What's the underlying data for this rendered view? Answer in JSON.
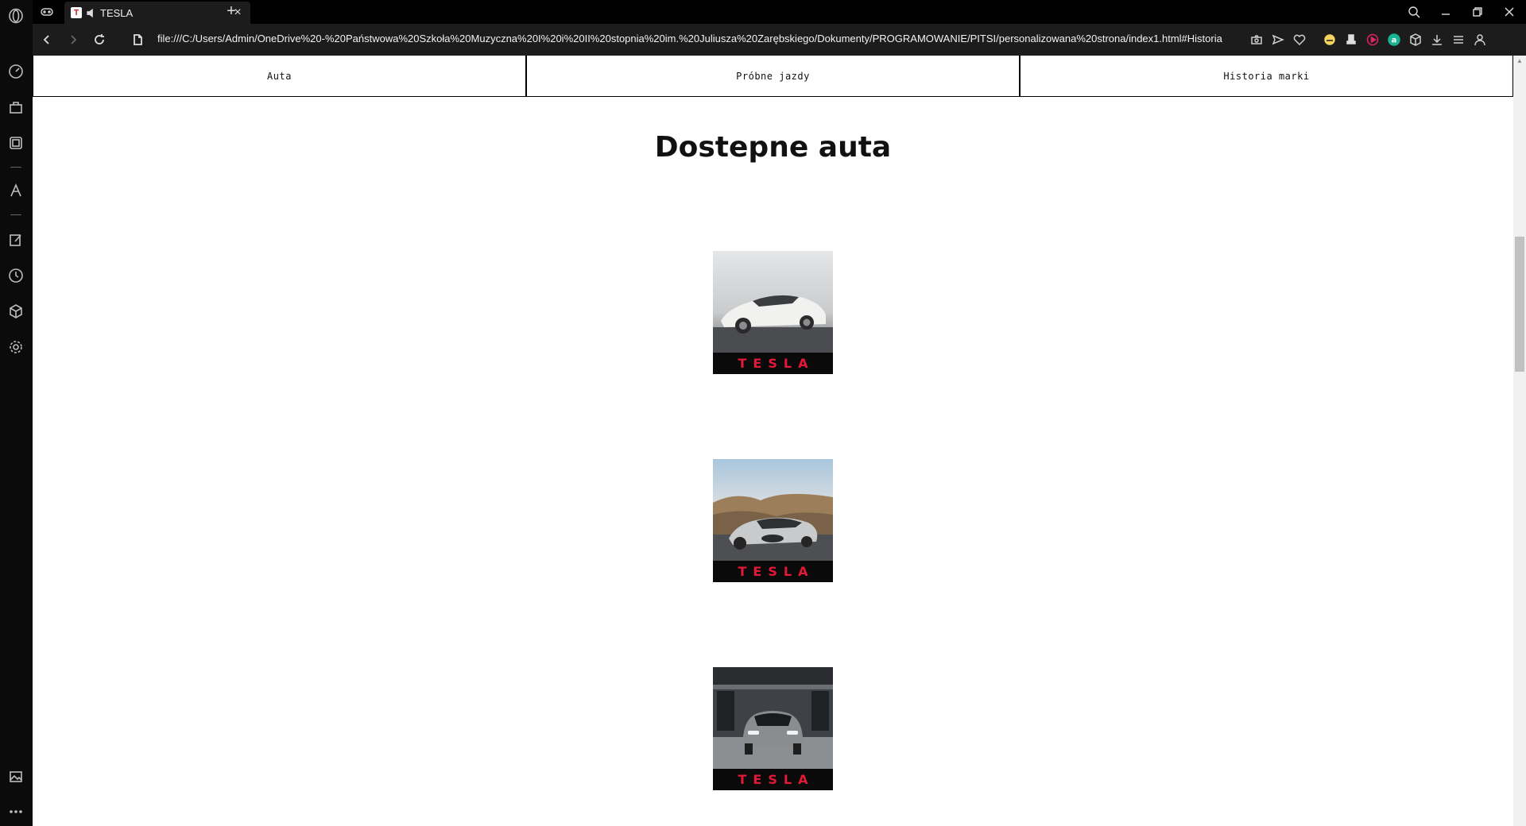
{
  "browser": {
    "tab": {
      "title": "TESLA",
      "favicon_letter": "T"
    },
    "address": {
      "url": "file:///C:/Users/Admin/OneDrive%20-%20Państwowa%20Szkoła%20Muzyczna%20I%20i%20II%20stopnia%20im.%20Juliusza%20Zarębskiego/Dokumenty/PROGRAMOWANIE/PITSI/personalizowana%20strona/index1.html#Historia"
    },
    "new_tab_label": "+",
    "close_tab_label": "×"
  },
  "page": {
    "nav": [
      {
        "label": "Auta"
      },
      {
        "label": "Próbne jazdy"
      },
      {
        "label": "Historia marki"
      }
    ],
    "heading": "Dostepne auta",
    "cars": [
      {
        "logo": "TESLA",
        "style": "white-sedan"
      },
      {
        "logo": "TESLA",
        "style": "silver-sedan-desert"
      },
      {
        "logo": "TESLA",
        "style": "grey-suv-front"
      }
    ]
  },
  "colors": {
    "tesla_red": "#e31937",
    "chrome_dark": "#1c1c1c"
  }
}
